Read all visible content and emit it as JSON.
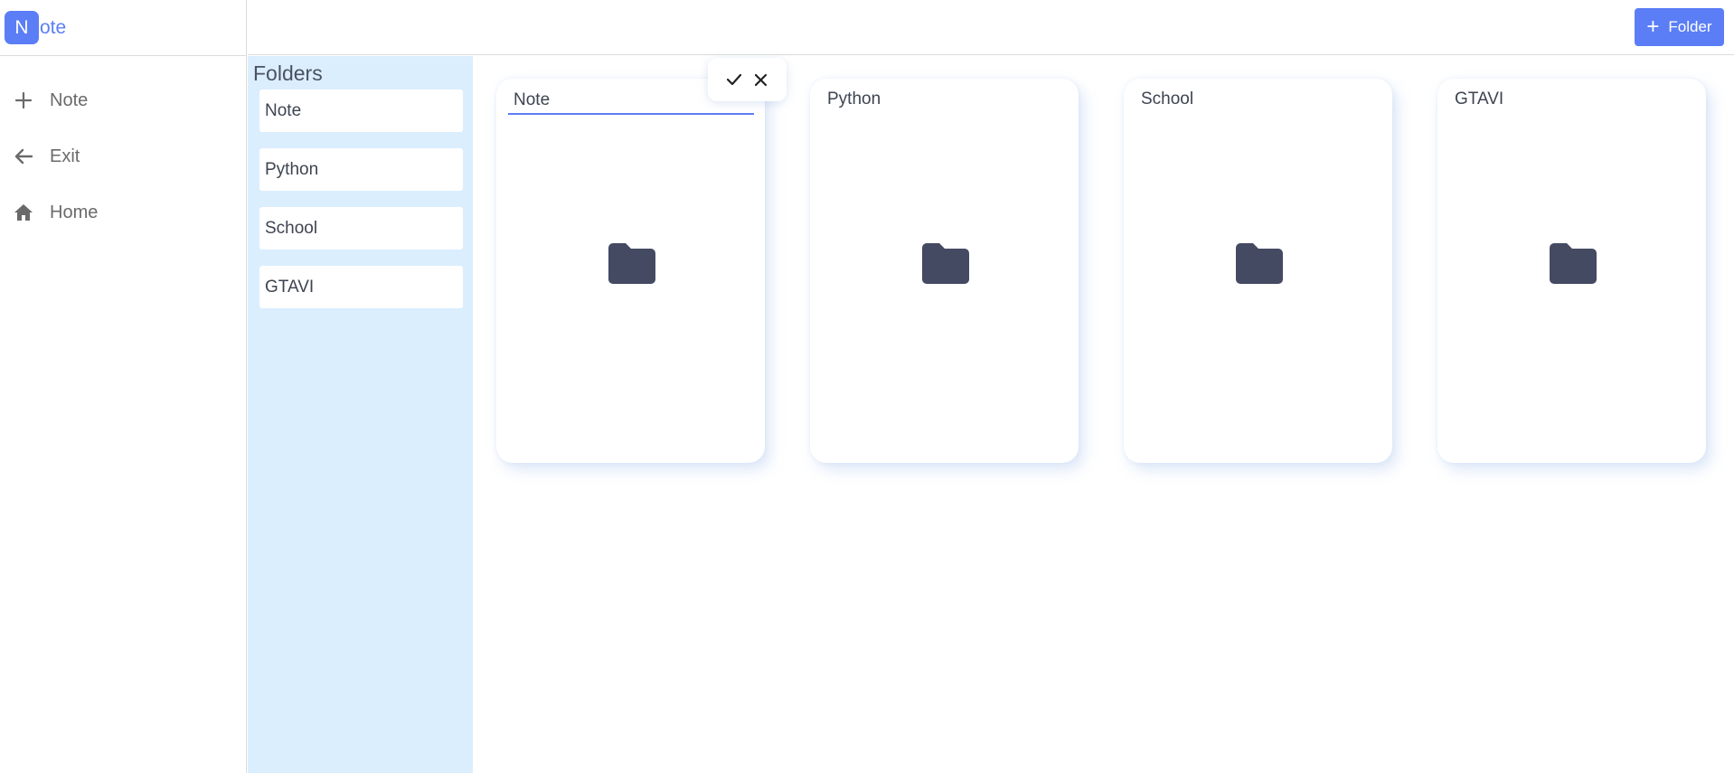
{
  "brand": {
    "badge": "N",
    "rest": "ote"
  },
  "sidebar": {
    "items": [
      {
        "label": "Note",
        "icon": "plus-icon"
      },
      {
        "label": "Exit",
        "icon": "arrow-left-icon"
      },
      {
        "label": "Home",
        "icon": "home-icon"
      }
    ]
  },
  "header": {
    "add_folder_label": "Folder"
  },
  "folders_panel": {
    "title": "Folders",
    "items": [
      "Note",
      "Python",
      "School",
      "GTAVI"
    ]
  },
  "cards": [
    {
      "title": "Note",
      "editing": true
    },
    {
      "title": "Python"
    },
    {
      "title": "School"
    },
    {
      "title": "GTAVI"
    }
  ],
  "colors": {
    "accent": "#5b7ef6",
    "panel_bg": "#dbeefe",
    "folder_icon": "#454a63"
  }
}
